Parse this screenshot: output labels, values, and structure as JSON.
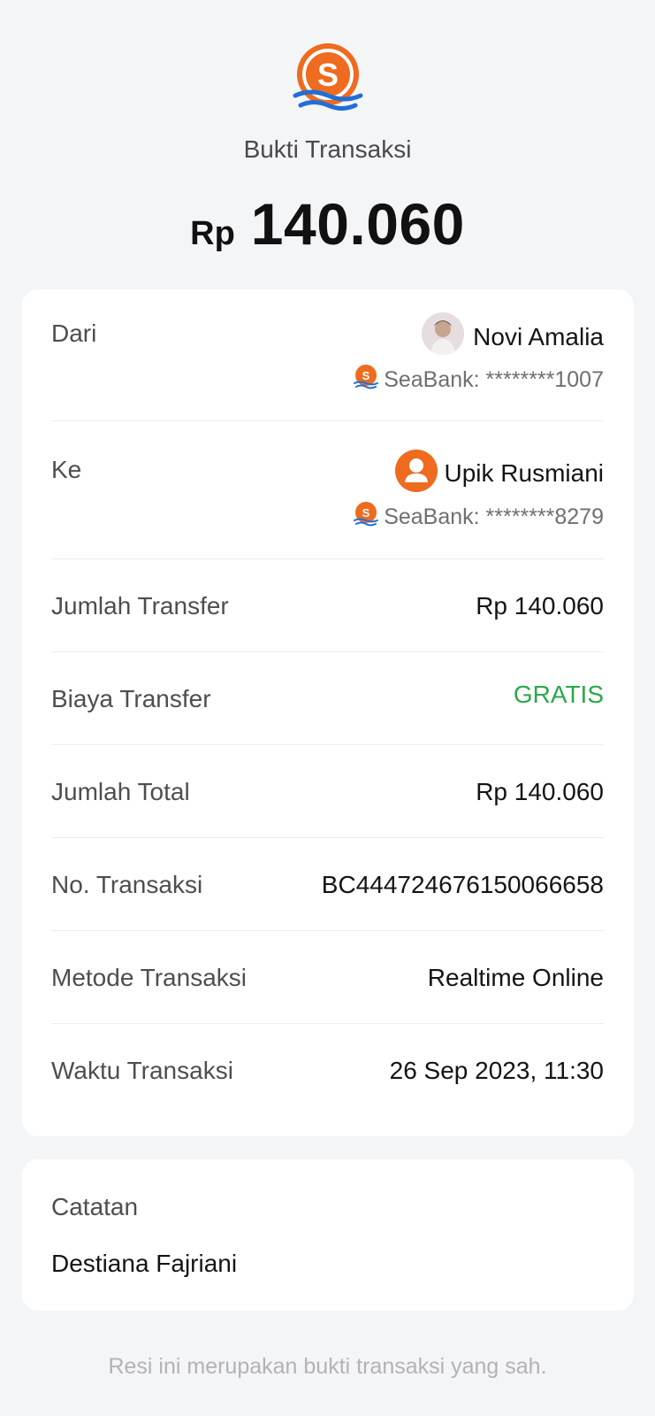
{
  "header": {
    "logo_icon": "seabank-logo-icon",
    "title": "Bukti Transaksi",
    "currency": "Rp",
    "amount": "140.060"
  },
  "from": {
    "label": "Dari",
    "name": "Novi Amalia",
    "avatar_icon": "user-photo-avatar",
    "bank": "SeaBank: ********1007"
  },
  "to": {
    "label": "Ke",
    "name": "Upik Rusmiani",
    "avatar_icon": "user-icon",
    "bank": "SeaBank: ********8279"
  },
  "rows": [
    {
      "label": "Jumlah Transfer",
      "value": "Rp 140.060"
    },
    {
      "label": "Biaya Transfer",
      "value": "GRATIS"
    },
    {
      "label": "Jumlah Total",
      "value": "Rp 140.060"
    },
    {
      "label": "No. Transaksi",
      "value": "BC444724676150066658"
    },
    {
      "label": "Metode Transaksi",
      "value": "Realtime Online"
    },
    {
      "label": "Waktu Transaksi",
      "value": "26 Sep 2023, 11:30"
    }
  ],
  "note": {
    "label": "Catatan",
    "value": "Destiana Fajriani"
  },
  "footer": "Resi ini merupakan bukti transaksi yang sah.",
  "colors": {
    "brand_orange": "#ee6b1f",
    "brand_blue": "#1f6fd6",
    "free_green": "#2aa84a",
    "background": "#f4f5f7"
  }
}
